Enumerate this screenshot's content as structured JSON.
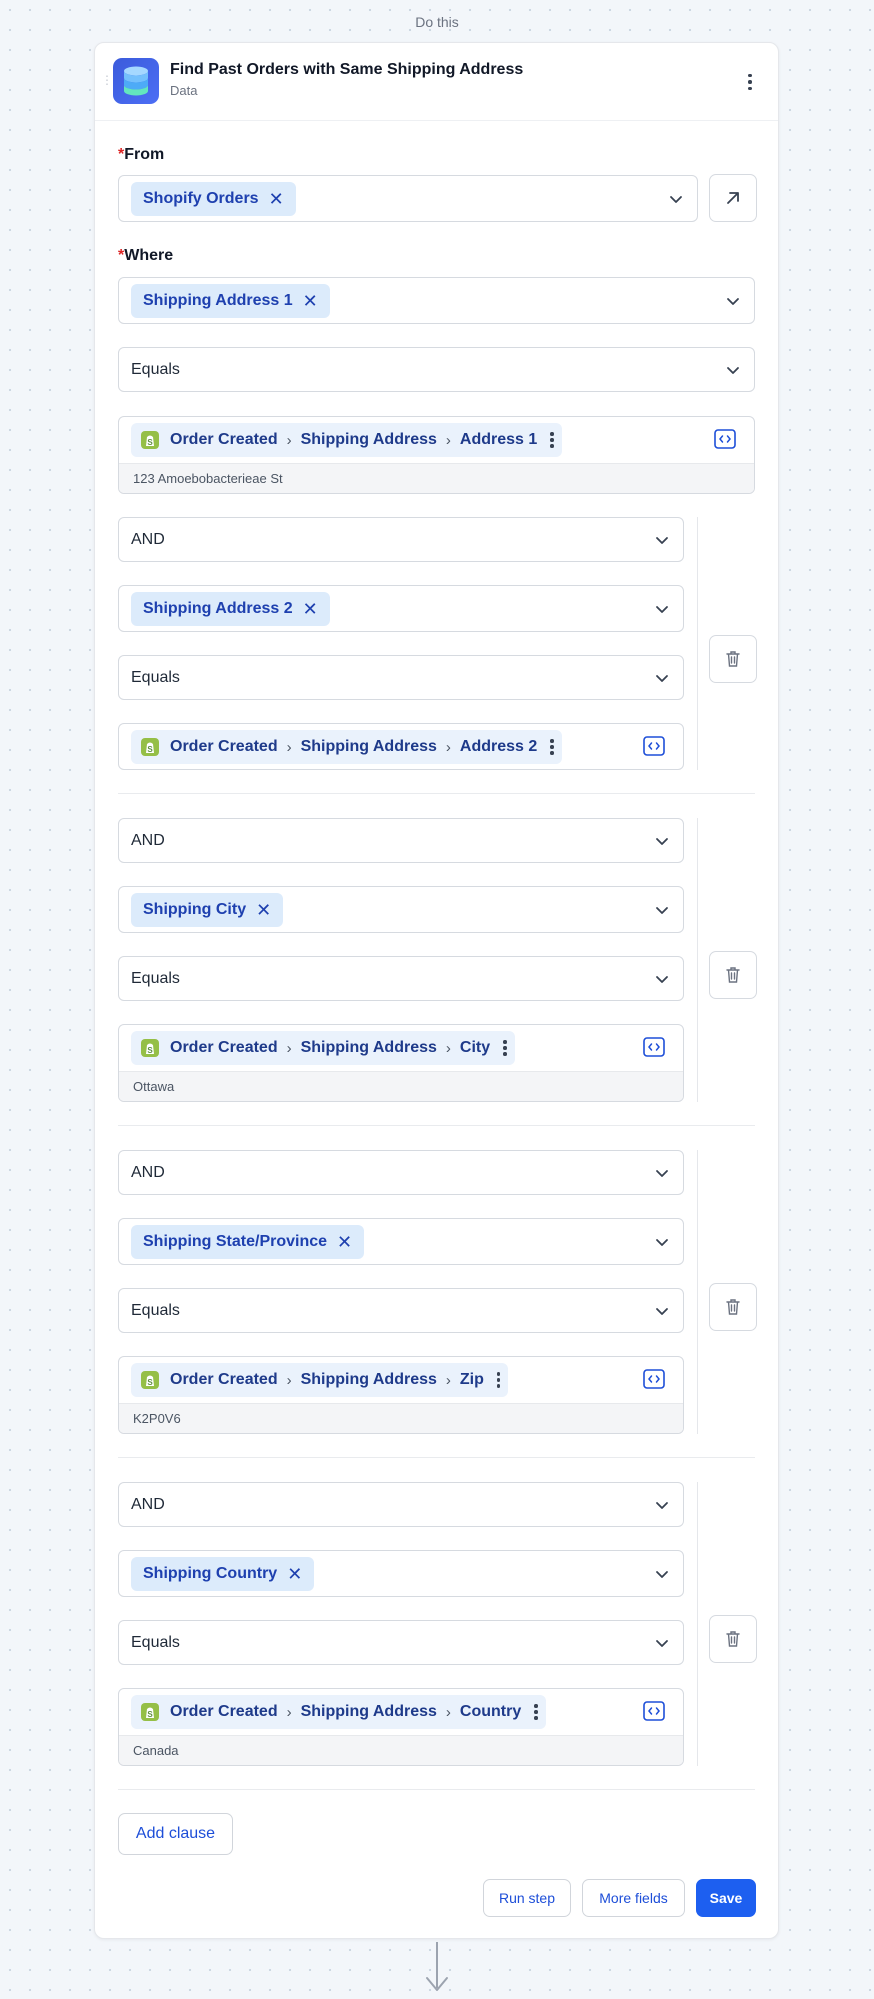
{
  "top_label": "Do this",
  "step": {
    "title": "Find Past Orders with Same Shipping Address",
    "subtitle": "Data",
    "icon": "database-icon",
    "accent_color": "#3b5bdb"
  },
  "from": {
    "label": "From",
    "value": "Shopify Orders"
  },
  "where": {
    "label": "Where",
    "field": "Shipping Address 1",
    "operator": "Equals",
    "variable": {
      "source": "Order Created",
      "group": "Shipping Address",
      "field": "Address 1"
    },
    "preview": "123 Amoebobacterieae St"
  },
  "clauses": [
    {
      "conjunction": "AND",
      "field": "Shipping Address 2",
      "operator": "Equals",
      "variable": {
        "source": "Order Created",
        "group": "Shipping Address",
        "field": "Address 2"
      },
      "preview": ""
    },
    {
      "conjunction": "AND",
      "field": "Shipping City",
      "operator": "Equals",
      "variable": {
        "source": "Order Created",
        "group": "Shipping Address",
        "field": "City"
      },
      "preview": "Ottawa"
    },
    {
      "conjunction": "AND",
      "field": "Shipping State/Province",
      "operator": "Equals",
      "variable": {
        "source": "Order Created",
        "group": "Shipping Address",
        "field": "Zip"
      },
      "preview": "K2P0V6"
    },
    {
      "conjunction": "AND",
      "field": "Shipping Country",
      "operator": "Equals",
      "variable": {
        "source": "Order Created",
        "group": "Shipping Address",
        "field": "Country"
      },
      "preview": "Canada"
    }
  ],
  "buttons": {
    "add_clause": "Add clause",
    "run_step": "Run step",
    "more_fields": "More fields",
    "save": "Save"
  },
  "colors": {
    "chip_bg": "#dcebfb",
    "chip_text": "#1e40af",
    "primary": "#1d5ff0",
    "required": "#dc2626"
  }
}
